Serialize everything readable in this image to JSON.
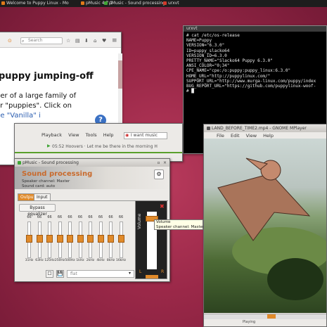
{
  "taskbar": {
    "tasks": [
      {
        "label": "Welcome to Puppy Linux - Mo",
        "color": "#e07a1a"
      },
      {
        "label": "pMusic 4.7.1",
        "color": "#e07a1a"
      },
      {
        "label": "pMusic - Sound processing",
        "color": "#3fa535"
      },
      {
        "label": "urxvt",
        "color": "#d23a2a"
      }
    ]
  },
  "browser": {
    "search_placeholder": "Search",
    "heading": "puppy jumping-off",
    "lines": [
      "ber of a large family of",
      "or \"puppies\". Click on",
      "he \"Vanilla\" i"
    ],
    "help_glyph": "?"
  },
  "terminal": {
    "title": "urxvt",
    "content": "# cat /etc/os-release\nNAME=Puppy\nVERSION=\"6.3.0\"\nID=puppy_slacko64\nVERSION_ID=6.3.0\nPRETTY_NAME=\"Slacko64 Puppy 6.3.0\"\nANSI_COLOR=\"0;34\"\nCPE_NAME=\"cpe:/o:puppy:puppy_linux:6.3.0\"\nHOME_URL=\"http://puppylinux.com/\"\nSUPPORT_URL=\"http://www.murga-linux.com/puppy/index\nBUG_REPORT_URL=\"https://github.com/puppylinux-woof-\n# █"
  },
  "pmusic": {
    "menu": [
      "Playback",
      "View",
      "Tools",
      "Help"
    ],
    "search_text": "I want music",
    "now_playing": "05:52  Hoovers · Let me be there in the morning  H"
  },
  "sound": {
    "title": "pMusic - Sound processing",
    "heading": "Sound processing",
    "speaker": "Speaker channel: Master",
    "card": "Sound card: auto",
    "tabs": [
      "Output",
      "Input"
    ],
    "bypass_label": "Bypass equalizer",
    "eq": [
      {
        "value": "66",
        "label": "31Hz"
      },
      {
        "value": "66",
        "label": "63Hz"
      },
      {
        "value": "66",
        "label": "125Hz"
      },
      {
        "value": "66",
        "label": "250Hz"
      },
      {
        "value": "66",
        "label": "500Hz"
      },
      {
        "value": "66",
        "label": "1kHz"
      },
      {
        "value": "66",
        "label": "2kHz"
      },
      {
        "value": "66",
        "label": "4kHz"
      },
      {
        "value": "66",
        "label": "8kHz"
      },
      {
        "value": "66",
        "label": "16kHz"
      }
    ],
    "preset": "flat"
  },
  "volume": {
    "label": "Volume",
    "tooltip_title": "Volume",
    "tooltip_body": "Speaker channel: Master",
    "left": "L",
    "right": "R",
    "level": 0.92
  },
  "mplayer": {
    "title": "LAND_BEFORE_TIME2.mp4 - GNOME MPlayer",
    "menu": [
      "File",
      "Edit",
      "View",
      "Help"
    ],
    "status": "Playing",
    "progress": 0.55
  }
}
